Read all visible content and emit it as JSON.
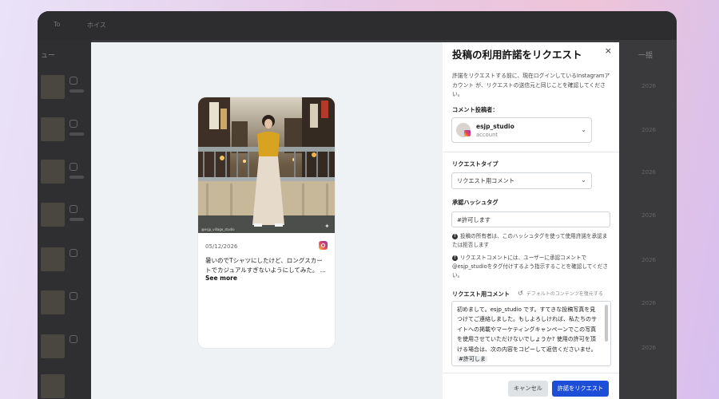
{
  "background": {
    "tab1": "To",
    "tab2": "ホイス",
    "side_label": "ュー",
    "right_title": "一揺",
    "row_number": "2026"
  },
  "preview": {
    "date": "05/12/2026",
    "caption": "暑いのでTシャツにしたけど、ロングスカートでカジュアルすぎないようにしてみた。 ...",
    "see_more": "See more",
    "photo_credit": "@esjp_village_studio",
    "platform_icon": "instagram-icon"
  },
  "panel": {
    "title": "投稿の利用許諾をリクエスト",
    "close": "×",
    "intro": "許諾をリクエストする前に、現在ログインしているInstagramアカウント が、リクエストの送信元と同じことを確認してください。",
    "commenter_label": "コメント投稿者：",
    "account_name": "esjp_studio",
    "account_sub": "account",
    "request_type_label": "リクエストタイプ",
    "request_type_value": "リクエスト用コメント",
    "hashtag_label": "承認ハッシュタグ",
    "hashtag_value": "#許可します",
    "note1": "投稿の所有者は、このハッシュタグを使って使用許諾を承認または拒否します",
    "note2": "リクエストコメントには、ユーザーに承認コメントで@esjp_studioをタグ付けするよう指示することを確認してください。",
    "comment_label": "リクエスト用コメント",
    "reset_label": "デフォルトのコンテンツを復元する",
    "comment_text": "初めまして。esjp_studio です。すてきな投稿写真を見つけてご連絡しました。もしよろしければ、私たちのサイトへの掲載やマーケティングキャンペーンでこの写真を使用させていただけないでしょうか? 使用の許可を頂ける場合は、次の内容をコピーして返信くださいませ。",
    "comment_tag": "#許可しま",
    "cancel": "キャンセル",
    "submit": "許諾をリクエスト",
    "accent": "#1d4ed8"
  }
}
